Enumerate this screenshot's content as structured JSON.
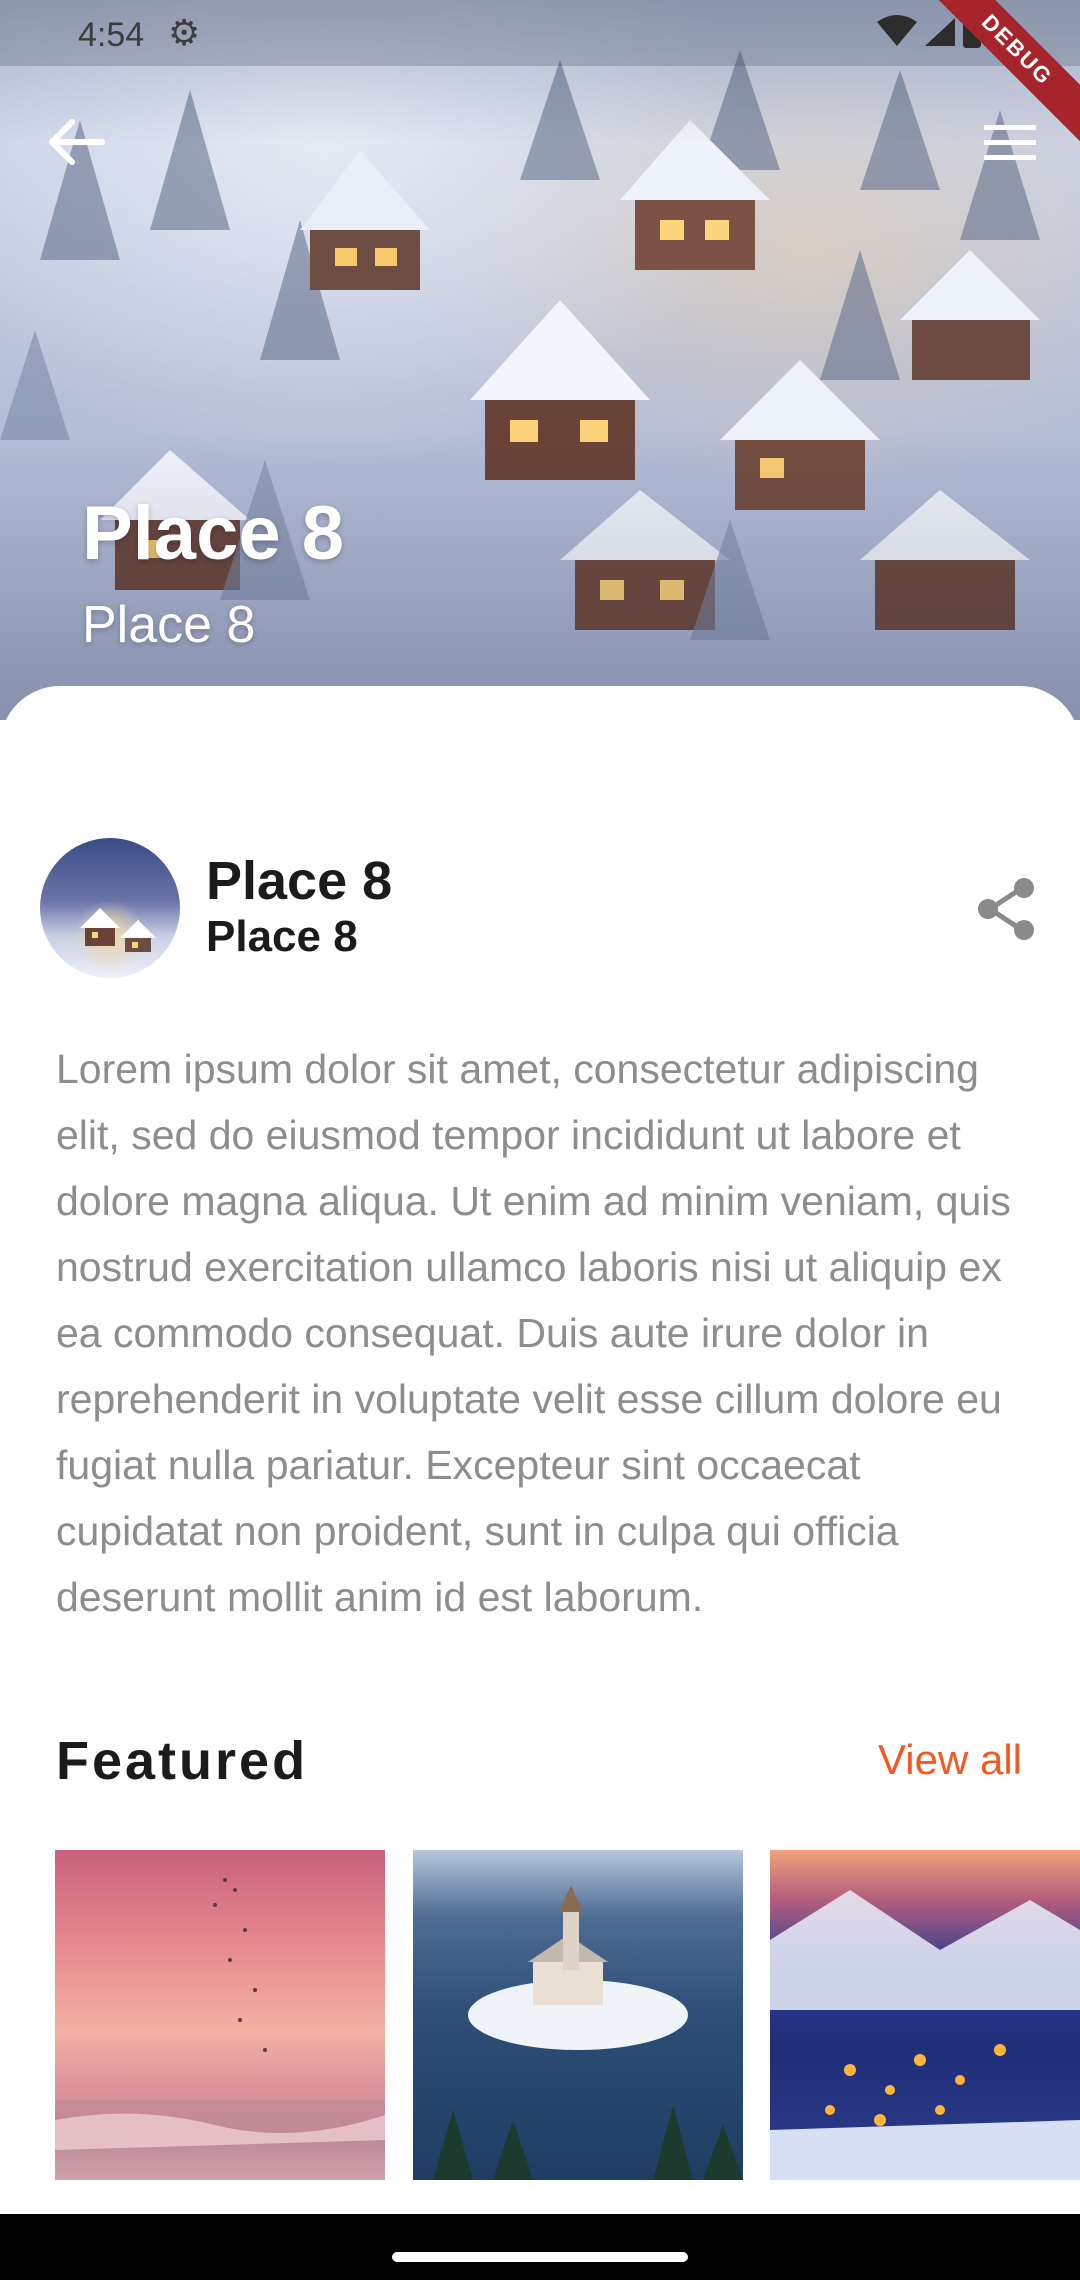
{
  "status_bar": {
    "time": "4:54",
    "debug_label": "DEBUG"
  },
  "hero": {
    "title": "Place 8",
    "subtitle": "Place 8"
  },
  "place": {
    "name": "Place 8",
    "subname": "Place 8"
  },
  "description": "Lorem ipsum dolor sit amet, consectetur adipiscing elit, sed do eiusmod tempor incididunt ut labore et dolore magna aliqua. Ut enim ad minim veniam, quis nostrud exercitation ullamco laboris nisi ut aliquip ex ea commodo consequat. Duis aute irure dolor in reprehenderit in voluptate velit esse cillum dolore eu fugiat nulla pariatur. Excepteur sint occaecat cupidatat non proident, sunt in culpa qui officia deserunt mollit anim id est laborum.",
  "featured": {
    "title": "Featured",
    "view_all": "View all"
  },
  "colors": {
    "accent": "#f15a22",
    "debug_ribbon": "#a8242b",
    "text_primary": "#1b1b1b",
    "text_secondary": "#8d8d8d"
  },
  "icons": {
    "back": "arrow-left-icon",
    "menu": "hamburger-menu-icon",
    "share": "share-icon",
    "settings": "gear-icon",
    "wifi": "wifi-icon",
    "signal": "signal-icon",
    "battery": "battery-icon"
  }
}
